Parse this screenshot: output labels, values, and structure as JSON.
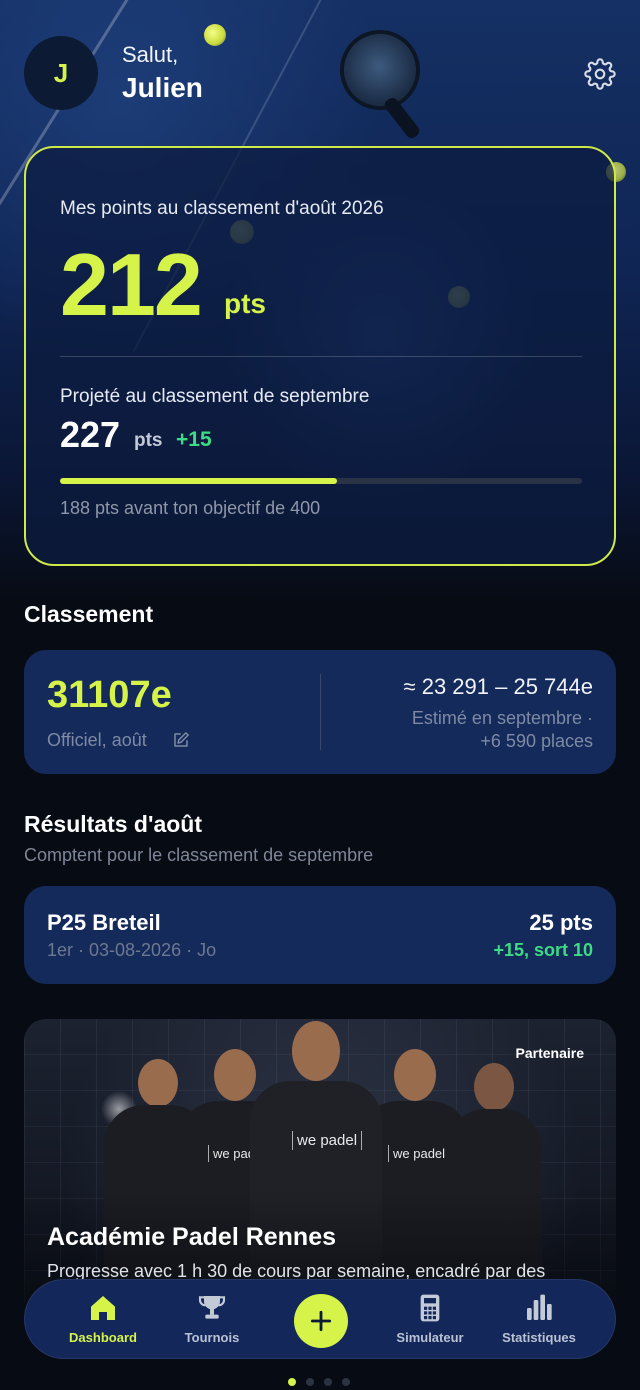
{
  "header": {
    "avatar_initial": "J",
    "greeting": "Salut,",
    "user_name": "Julien",
    "settings_icon": "gear-icon"
  },
  "points_card": {
    "title": "Mes points au classement d'août 2026",
    "points": "212",
    "points_unit": "pts",
    "projection_title": "Projeté au classement de septembre",
    "projected_points": "227",
    "projected_unit": "pts",
    "projected_delta": "+15",
    "progress_fraction": 0.53,
    "goal_text": "188 pts avant ton objectif de 400"
  },
  "ranking": {
    "section_title": "Classement",
    "official_rank": "31107e",
    "official_label": "Officiel, août",
    "edit_icon": "edit-icon",
    "estimate_range": "≈ 23 291 – 25 744e",
    "estimate_line1": "Estimé en septembre ·",
    "estimate_line2": "+6 590 places"
  },
  "results": {
    "section_title": "Résultats d'août",
    "section_subtitle": "Comptent pour le classement de septembre",
    "items": [
      {
        "name": "P25 Breteil",
        "meta": "1er · 03-08-2026 · Jo",
        "points": "25 pts",
        "delta": "+15, sort 10"
      }
    ]
  },
  "partner": {
    "badge": "Partenaire",
    "title": "Académie Padel Rennes",
    "description": "Progresse avec 1 h 30 de cours par semaine, encadré par des",
    "shirt_logo": "we padel"
  },
  "tabbar": {
    "items": [
      {
        "label": "Dashboard",
        "icon": "home-icon",
        "active": true
      },
      {
        "label": "Tournois",
        "icon": "trophy-icon",
        "active": false
      },
      {
        "label": "",
        "icon": "plus-icon",
        "active": false
      },
      {
        "label": "Simulateur",
        "icon": "calculator-icon",
        "active": false
      },
      {
        "label": "Statistiques",
        "icon": "bar-chart-icon",
        "active": false
      }
    ]
  },
  "page_dots": {
    "count": 4,
    "active_index": 0
  },
  "colors": {
    "accent": "#d6f34a",
    "positive": "#3ddc84",
    "card": "#142a5a",
    "background": "#070b14"
  }
}
